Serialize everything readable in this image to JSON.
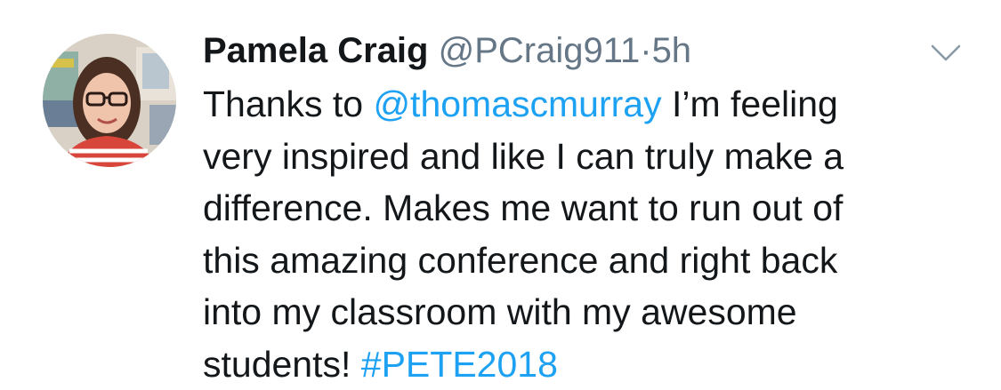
{
  "tweet": {
    "author_name": "Pamela Craig",
    "handle": "@PCraig911",
    "separator": "·",
    "time": "5h",
    "lines": [
      {
        "before": "Thanks to ",
        "mention": "@thomascmurray",
        "after": " I’m feeling"
      },
      {
        "text": "very inspired and like I can truly make a"
      },
      {
        "text": "difference. Makes me want to run out of"
      },
      {
        "text": "this amazing conference and right back"
      },
      {
        "text": "into my classroom with my awesome"
      },
      {
        "before": "students! ",
        "hashtag": "#PETE2018"
      }
    ],
    "icons": {
      "avatar": "profile-photo",
      "menu": "chevron-down-icon"
    },
    "colors": {
      "link": "#1da1f2",
      "text": "#14171a",
      "secondary": "#657786"
    }
  }
}
